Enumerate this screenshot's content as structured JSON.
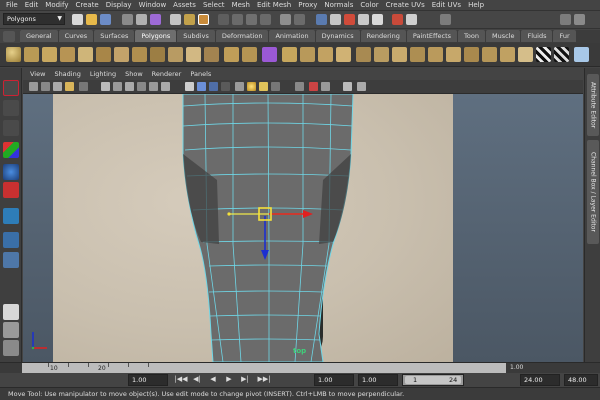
{
  "menubar": [
    "File",
    "Edit",
    "Modify",
    "Create",
    "Display",
    "Window",
    "Assets",
    "Select",
    "Mesh",
    "Edit Mesh",
    "Proxy",
    "Normals",
    "Color",
    "Create UVs",
    "Edit UVs",
    "Help"
  ],
  "statusline": {
    "mode": "Polygons"
  },
  "shelf": {
    "tabs": [
      "General",
      "Curves",
      "Surfaces",
      "Polygons",
      "Subdivs",
      "Deformation",
      "Animation",
      "Dynamics",
      "Rendering",
      "PaintEffects",
      "Toon",
      "Muscle",
      "Fluids",
      "Fur"
    ],
    "active_tab": "Polygons"
  },
  "panel": {
    "menu": [
      "View",
      "Shading",
      "Lighting",
      "Show",
      "Renderer",
      "Panels"
    ],
    "camera": "top"
  },
  "right_dock": {
    "tabs": [
      "Attribute Editor",
      "Channel Box / Layer Editor"
    ]
  },
  "timeslider": {
    "ticks": [
      "10",
      "20"
    ],
    "current_frame": "1.00"
  },
  "range": {
    "start_time": "1.00",
    "playback_start": "1.00",
    "playback_start2": "1.00",
    "slider_start": "1",
    "slider_end": "24",
    "playback_end": "24.00",
    "end_time": "48.00"
  },
  "playback_buttons": [
    "|◀◀",
    "◀|",
    "◀",
    "▶",
    "▶|",
    "▶▶|"
  ],
  "helpline": "Move Tool: Use manipulator to move object(s). Use edit mode to change pivot (INSERT).  Ctrl+LMB to move perpendicular.",
  "colors": {
    "mesh_wire": "#6fd6e6",
    "mesh_fill": "#6b6b6b",
    "axis_x": "#e02020",
    "axis_y": "#1b2fd1",
    "manip_center": "#f5e23a",
    "camera_label": "#3fd07a"
  }
}
